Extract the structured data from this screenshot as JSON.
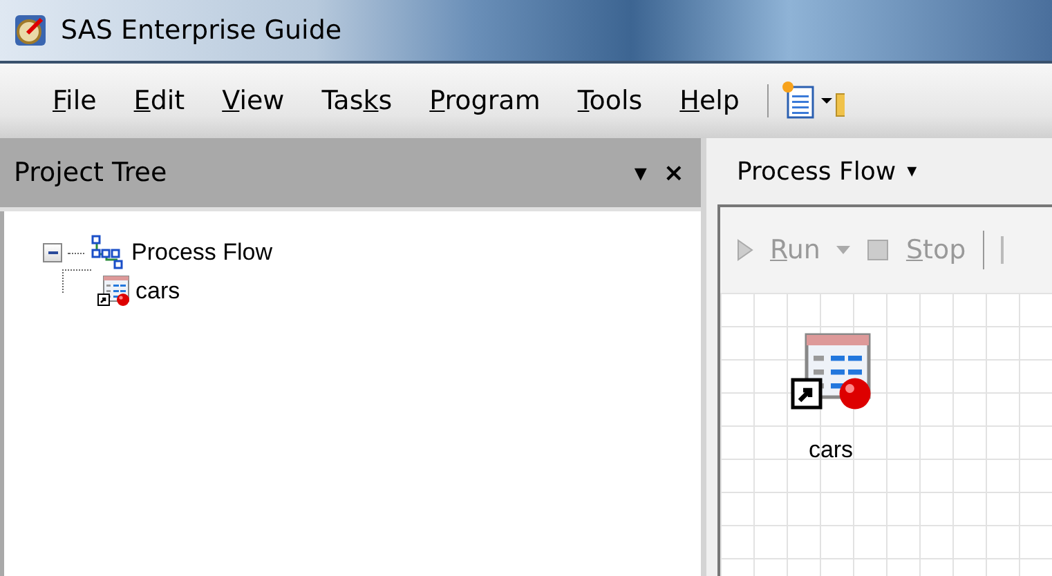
{
  "window": {
    "title": "SAS Enterprise Guide"
  },
  "menu": [
    {
      "access_key": "F",
      "after": "ile"
    },
    {
      "access_key": "E",
      "after": "dit"
    },
    {
      "access_key": "V",
      "after": "iew"
    },
    {
      "before": "Tas",
      "access_key": "k",
      "after": "s"
    },
    {
      "access_key": "P",
      "after": "rogram"
    },
    {
      "access_key": "T",
      "after": "ools"
    },
    {
      "access_key": "H",
      "after": "elp"
    }
  ],
  "project_tree": {
    "title": "Project Tree",
    "pin": "▾",
    "close": "×",
    "items": [
      {
        "label": "Process Flow",
        "expanded": true,
        "kind": "flow",
        "children": [
          {
            "label": "cars",
            "kind": "dataset"
          }
        ]
      }
    ]
  },
  "process_flow": {
    "tab": "Process Flow",
    "tab_caret": "▾",
    "toolbar": [
      {
        "access_key": "R",
        "after": "un",
        "kind": "run",
        "disabled": true
      },
      {
        "access_key": "S",
        "after": "top",
        "kind": "stop",
        "disabled": true
      }
    ],
    "nodes": [
      {
        "label": "cars",
        "kind": "dataset"
      }
    ]
  }
}
